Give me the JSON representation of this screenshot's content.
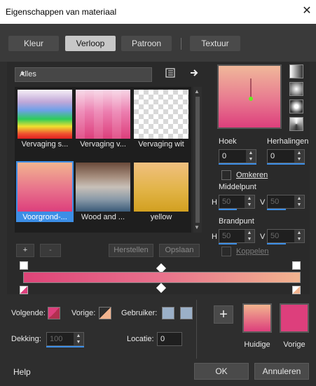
{
  "window": {
    "title": "Eigenschappen van materiaal",
    "close_glyph": "✕"
  },
  "tabs": [
    {
      "label": "Kleur",
      "active": false
    },
    {
      "label": "Verloop",
      "active": true
    },
    {
      "label": "Patroon",
      "active": false
    },
    {
      "label": "Textuur",
      "active": false
    }
  ],
  "gallery": {
    "category": "Alles",
    "items": [
      {
        "label": "Vervaging s...",
        "selected": false
      },
      {
        "label": "Vervaging v...",
        "selected": false
      },
      {
        "label": "Vervaging wit",
        "selected": false
      },
      {
        "label": "Voorgrond-...",
        "selected": true
      },
      {
        "label": "Wood and ...",
        "selected": false
      },
      {
        "label": "yellow",
        "selected": false
      }
    ],
    "add_label": "+",
    "remove_label": "-",
    "reset_label": "Herstellen",
    "save_label": "Opslaan"
  },
  "settings": {
    "angle_label": "Hoek",
    "angle_value": "0",
    "repeats_label": "Herhalingen",
    "repeats_value": "0",
    "invert_label": "Omkeren",
    "center_label": "Middelpunt",
    "center_h": "50",
    "center_v": "50",
    "focal_label": "Brandpunt",
    "focal_h": "50",
    "focal_v": "50",
    "link_label": "Koppelen",
    "h_label": "H",
    "v_label": "V"
  },
  "editor": {
    "next_label": "Volgende:",
    "prev_label": "Vorige:",
    "user_label": "Gebruiker:",
    "opacity_label": "Dekking:",
    "opacity_value": "100",
    "location_label": "Locatie:",
    "location_value": "0"
  },
  "swatches": {
    "current_label": "Huidige",
    "previous_label": "Vorige",
    "add_glyph": "+"
  },
  "footer": {
    "help": "Help",
    "ok": "OK",
    "cancel": "Annuleren"
  },
  "colors": {
    "accent": "#3c8ee6",
    "pink": "#dd3f7c",
    "peach": "#f2b48f"
  },
  "icons": {
    "list": "list-icon",
    "arrow": "arrow-right-icon"
  }
}
